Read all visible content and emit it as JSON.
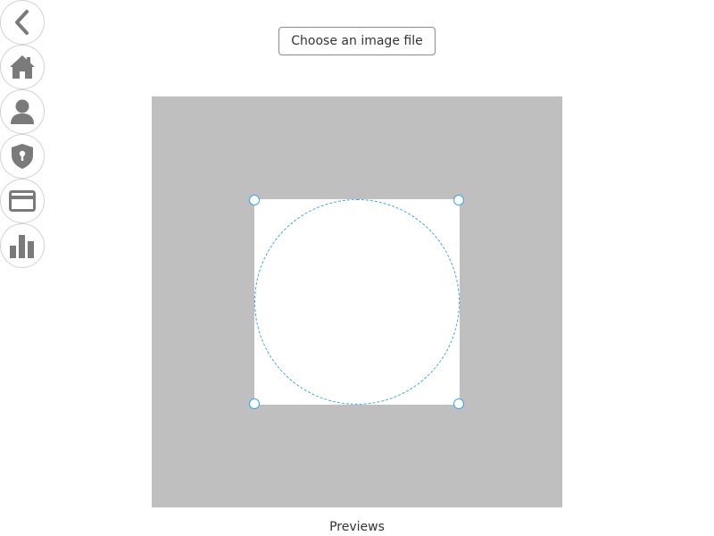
{
  "rail": {
    "items": [
      {
        "icon": "chevron-left-icon",
        "label": "Back"
      },
      {
        "icon": "home-icon",
        "label": "Home"
      },
      {
        "icon": "user-icon",
        "label": "Profile"
      },
      {
        "icon": "shield-icon",
        "label": "Security"
      },
      {
        "icon": "credit-card-icon",
        "label": "Billing"
      },
      {
        "icon": "bar-chart-icon",
        "label": "Stats"
      }
    ],
    "icon_color": "#7a7a7a"
  },
  "uploader": {
    "choose_label": "Choose an image file"
  },
  "cropper": {
    "stage_color": "#bfbfbf",
    "guide_color": "#39a6e8"
  },
  "previews": {
    "label": "Previews"
  }
}
